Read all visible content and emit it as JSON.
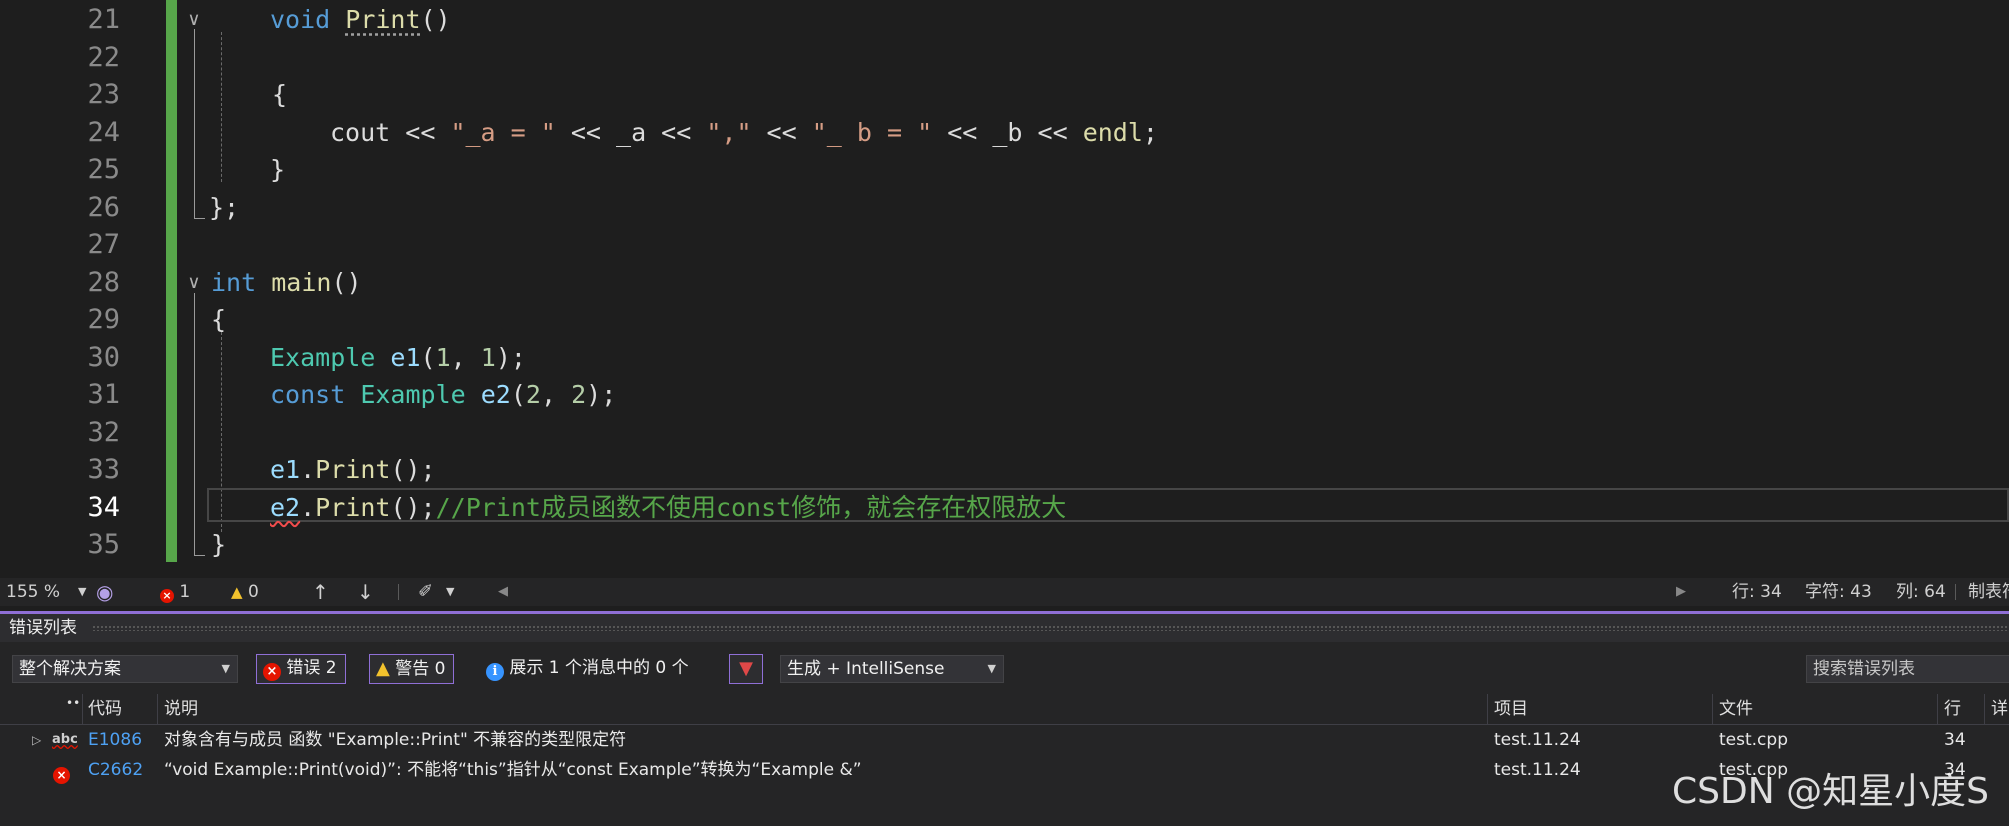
{
  "editor": {
    "lines": [
      {
        "n": "21",
        "current": false
      },
      {
        "n": "22",
        "current": false
      },
      {
        "n": "23",
        "current": false
      },
      {
        "n": "24",
        "current": false
      },
      {
        "n": "25",
        "current": false
      },
      {
        "n": "26",
        "current": false
      },
      {
        "n": "27",
        "current": false
      },
      {
        "n": "28",
        "current": false
      },
      {
        "n": "29",
        "current": false
      },
      {
        "n": "30",
        "current": false
      },
      {
        "n": "31",
        "current": false
      },
      {
        "n": "32",
        "current": false
      },
      {
        "n": "33",
        "current": false
      },
      {
        "n": "34",
        "current": true
      },
      {
        "n": "35",
        "current": false
      }
    ],
    "code": {
      "l21": {
        "kw": "void",
        "fn": "Print",
        "rest": "()"
      },
      "l23": "{",
      "l24": {
        "a": "cout",
        "b": " << ",
        "s1": "\"_a = \"",
        "c": " << ",
        "v1": "_a",
        "d": " << ",
        "s2": "\",\"",
        "e": " << ",
        "s3": "\"_ b = \"",
        "f": " << ",
        "v2": "_b",
        "g": " << ",
        "fn": "endl",
        "h": ";"
      },
      "l25": "}",
      "l26": "};",
      "l28": {
        "kw": "int",
        "fn": "main",
        "rest": "()"
      },
      "l29": "{",
      "l30": {
        "ty": "Example",
        "v": "e1",
        "p1": "(",
        "n1": "1",
        "c": ", ",
        "n2": "1",
        "p2": ");"
      },
      "l31": {
        "kw": "const",
        "ty": "Example",
        "v": "e2",
        "p1": "(",
        "n1": "2",
        "c": ", ",
        "n2": "2",
        "p2": ");"
      },
      "l33": {
        "v": "e1",
        "dot": ".",
        "fn": "Print",
        "rest": "();"
      },
      "l34": {
        "v": "e2",
        "dot": ".",
        "fn": "Print",
        "rest": "();",
        "comment": "//Print成员函数不使用const修饰，就会存在权限放大"
      },
      "l35": "}"
    }
  },
  "status_bar": {
    "zoom": "155 %",
    "errors": "1",
    "warnings": "0",
    "line": "行: 34",
    "char": "字符: 43",
    "col": "列: 64",
    "tabs": "制表符"
  },
  "error_list": {
    "title": "错误列表",
    "scope": "整个解决方案",
    "errors_btn": "错误 2",
    "warnings_btn": "警告 0",
    "messages_btn": "展示 1 个消息中的 0 个",
    "build_filter": "生成 + IntelliSense",
    "search_placeholder": "搜索错误列表",
    "columns": {
      "code": "代码",
      "desc": "说明",
      "project": "项目",
      "file": "文件",
      "line": "行",
      "detail": "详"
    },
    "rows": [
      {
        "code": "E1086",
        "desc": "对象含有与成员 函数 \"Example::Print\" 不兼容的类型限定符",
        "project": "test.11.24",
        "file": "test.cpp",
        "line": "34",
        "icon": "intellisense-abc-icon"
      },
      {
        "code": "C2662",
        "desc": "“void Example::Print(void)”: 不能将“this”指针从“const Example”转换为“Example &”",
        "project": "test.11.24",
        "file": "test.cpp",
        "line": "34",
        "icon": "error-icon"
      }
    ]
  },
  "watermark": "CSDN @知星小度S",
  "colors": {
    "accent": "#8f6fd6",
    "change_bar": "#57a64a",
    "error": "#e51400",
    "keyword": "#569cd6",
    "type": "#4ec9b0",
    "function": "#dcdcaa",
    "string": "#d69d85",
    "comment": "#57a64a"
  }
}
